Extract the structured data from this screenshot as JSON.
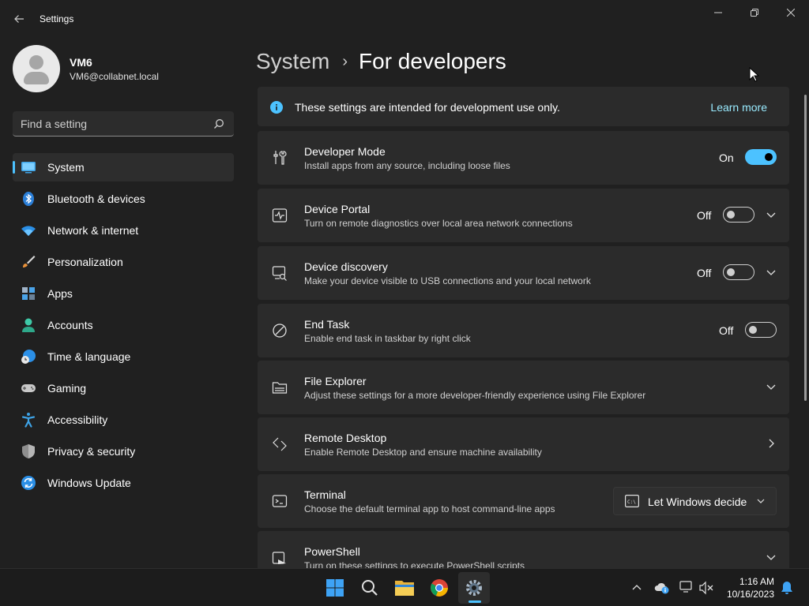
{
  "window": {
    "title": "Settings",
    "back_icon": "arrow-left-icon",
    "minimize_icon": "minimize-icon",
    "maximize_icon": "restore-icon",
    "close_icon": "close-icon"
  },
  "profile": {
    "name": "VM6",
    "email": "VM6@collabnet.local"
  },
  "search": {
    "placeholder": "Find a setting",
    "value": ""
  },
  "nav": {
    "items": [
      {
        "label": "System",
        "icon": "system-display-icon",
        "active": true
      },
      {
        "label": "Bluetooth & devices",
        "icon": "bluetooth-icon"
      },
      {
        "label": "Network & internet",
        "icon": "wifi-icon"
      },
      {
        "label": "Personalization",
        "icon": "paintbrush-icon"
      },
      {
        "label": "Apps",
        "icon": "apps-icon"
      },
      {
        "label": "Accounts",
        "icon": "accounts-icon"
      },
      {
        "label": "Time & language",
        "icon": "globe-clock-icon"
      },
      {
        "label": "Gaming",
        "icon": "gamepad-icon"
      },
      {
        "label": "Accessibility",
        "icon": "accessibility-icon"
      },
      {
        "label": "Privacy & security",
        "icon": "shield-icon"
      },
      {
        "label": "Windows Update",
        "icon": "windows-update-icon"
      }
    ]
  },
  "breadcrumb": {
    "parent": "System",
    "separator": "›",
    "current": "For developers"
  },
  "info": {
    "text": "These settings are intended for development use only.",
    "link": "Learn more"
  },
  "settings": {
    "developer_mode": {
      "title": "Developer Mode",
      "desc": "Install apps from any source, including loose files",
      "state": "On"
    },
    "device_portal": {
      "title": "Device Portal",
      "desc": "Turn on remote diagnostics over local area network connections",
      "state": "Off"
    },
    "device_discovery": {
      "title": "Device discovery",
      "desc": "Make your device visible to USB connections and your local network",
      "state": "Off"
    },
    "end_task": {
      "title": "End Task",
      "desc": "Enable end task in taskbar by right click",
      "state": "Off"
    },
    "file_explorer": {
      "title": "File Explorer",
      "desc": "Adjust these settings for a more developer-friendly experience using File Explorer"
    },
    "remote_desktop": {
      "title": "Remote Desktop",
      "desc": "Enable Remote Desktop and ensure machine availability"
    },
    "terminal": {
      "title": "Terminal",
      "desc": "Choose the default terminal app to host command-line apps",
      "dropdown_value": "Let Windows decide"
    },
    "powershell": {
      "title": "PowerShell",
      "desc": "Turn on these settings to execute PowerShell scripts"
    }
  },
  "taskbar": {
    "apps": [
      "windows-start-icon",
      "search-icon",
      "file-explorer-icon",
      "chrome-icon",
      "settings-gear-icon"
    ],
    "time": "1:16 AM",
    "date": "10/16/2023"
  },
  "colors": {
    "accent": "#4cc2ff",
    "link": "#99ebff",
    "background": "#202020",
    "card": "#2b2b2b"
  }
}
